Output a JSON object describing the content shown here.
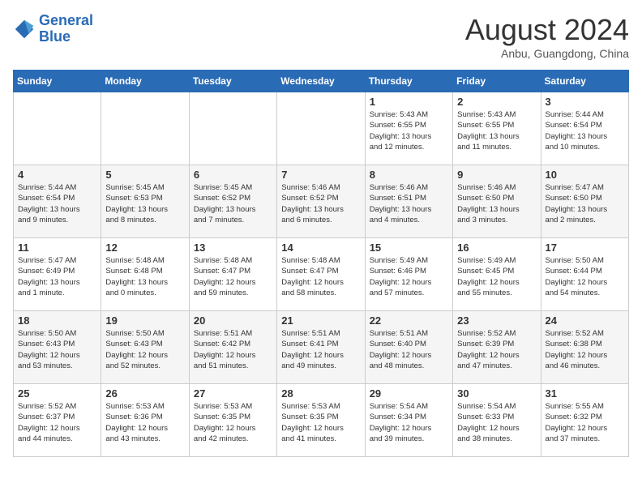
{
  "header": {
    "logo_line1": "General",
    "logo_line2": "Blue",
    "month": "August 2024",
    "location": "Anbu, Guangdong, China"
  },
  "weekdays": [
    "Sunday",
    "Monday",
    "Tuesday",
    "Wednesday",
    "Thursday",
    "Friday",
    "Saturday"
  ],
  "weeks": [
    [
      {
        "day": "",
        "info": ""
      },
      {
        "day": "",
        "info": ""
      },
      {
        "day": "",
        "info": ""
      },
      {
        "day": "",
        "info": ""
      },
      {
        "day": "1",
        "info": "Sunrise: 5:43 AM\nSunset: 6:55 PM\nDaylight: 13 hours\nand 12 minutes."
      },
      {
        "day": "2",
        "info": "Sunrise: 5:43 AM\nSunset: 6:55 PM\nDaylight: 13 hours\nand 11 minutes."
      },
      {
        "day": "3",
        "info": "Sunrise: 5:44 AM\nSunset: 6:54 PM\nDaylight: 13 hours\nand 10 minutes."
      }
    ],
    [
      {
        "day": "4",
        "info": "Sunrise: 5:44 AM\nSunset: 6:54 PM\nDaylight: 13 hours\nand 9 minutes."
      },
      {
        "day": "5",
        "info": "Sunrise: 5:45 AM\nSunset: 6:53 PM\nDaylight: 13 hours\nand 8 minutes."
      },
      {
        "day": "6",
        "info": "Sunrise: 5:45 AM\nSunset: 6:52 PM\nDaylight: 13 hours\nand 7 minutes."
      },
      {
        "day": "7",
        "info": "Sunrise: 5:46 AM\nSunset: 6:52 PM\nDaylight: 13 hours\nand 6 minutes."
      },
      {
        "day": "8",
        "info": "Sunrise: 5:46 AM\nSunset: 6:51 PM\nDaylight: 13 hours\nand 4 minutes."
      },
      {
        "day": "9",
        "info": "Sunrise: 5:46 AM\nSunset: 6:50 PM\nDaylight: 13 hours\nand 3 minutes."
      },
      {
        "day": "10",
        "info": "Sunrise: 5:47 AM\nSunset: 6:50 PM\nDaylight: 13 hours\nand 2 minutes."
      }
    ],
    [
      {
        "day": "11",
        "info": "Sunrise: 5:47 AM\nSunset: 6:49 PM\nDaylight: 13 hours\nand 1 minute."
      },
      {
        "day": "12",
        "info": "Sunrise: 5:48 AM\nSunset: 6:48 PM\nDaylight: 13 hours\nand 0 minutes."
      },
      {
        "day": "13",
        "info": "Sunrise: 5:48 AM\nSunset: 6:47 PM\nDaylight: 12 hours\nand 59 minutes."
      },
      {
        "day": "14",
        "info": "Sunrise: 5:48 AM\nSunset: 6:47 PM\nDaylight: 12 hours\nand 58 minutes."
      },
      {
        "day": "15",
        "info": "Sunrise: 5:49 AM\nSunset: 6:46 PM\nDaylight: 12 hours\nand 57 minutes."
      },
      {
        "day": "16",
        "info": "Sunrise: 5:49 AM\nSunset: 6:45 PM\nDaylight: 12 hours\nand 55 minutes."
      },
      {
        "day": "17",
        "info": "Sunrise: 5:50 AM\nSunset: 6:44 PM\nDaylight: 12 hours\nand 54 minutes."
      }
    ],
    [
      {
        "day": "18",
        "info": "Sunrise: 5:50 AM\nSunset: 6:43 PM\nDaylight: 12 hours\nand 53 minutes."
      },
      {
        "day": "19",
        "info": "Sunrise: 5:50 AM\nSunset: 6:43 PM\nDaylight: 12 hours\nand 52 minutes."
      },
      {
        "day": "20",
        "info": "Sunrise: 5:51 AM\nSunset: 6:42 PM\nDaylight: 12 hours\nand 51 minutes."
      },
      {
        "day": "21",
        "info": "Sunrise: 5:51 AM\nSunset: 6:41 PM\nDaylight: 12 hours\nand 49 minutes."
      },
      {
        "day": "22",
        "info": "Sunrise: 5:51 AM\nSunset: 6:40 PM\nDaylight: 12 hours\nand 48 minutes."
      },
      {
        "day": "23",
        "info": "Sunrise: 5:52 AM\nSunset: 6:39 PM\nDaylight: 12 hours\nand 47 minutes."
      },
      {
        "day": "24",
        "info": "Sunrise: 5:52 AM\nSunset: 6:38 PM\nDaylight: 12 hours\nand 46 minutes."
      }
    ],
    [
      {
        "day": "25",
        "info": "Sunrise: 5:52 AM\nSunset: 6:37 PM\nDaylight: 12 hours\nand 44 minutes."
      },
      {
        "day": "26",
        "info": "Sunrise: 5:53 AM\nSunset: 6:36 PM\nDaylight: 12 hours\nand 43 minutes."
      },
      {
        "day": "27",
        "info": "Sunrise: 5:53 AM\nSunset: 6:35 PM\nDaylight: 12 hours\nand 42 minutes."
      },
      {
        "day": "28",
        "info": "Sunrise: 5:53 AM\nSunset: 6:35 PM\nDaylight: 12 hours\nand 41 minutes."
      },
      {
        "day": "29",
        "info": "Sunrise: 5:54 AM\nSunset: 6:34 PM\nDaylight: 12 hours\nand 39 minutes."
      },
      {
        "day": "30",
        "info": "Sunrise: 5:54 AM\nSunset: 6:33 PM\nDaylight: 12 hours\nand 38 minutes."
      },
      {
        "day": "31",
        "info": "Sunrise: 5:55 AM\nSunset: 6:32 PM\nDaylight: 12 hours\nand 37 minutes."
      }
    ]
  ]
}
